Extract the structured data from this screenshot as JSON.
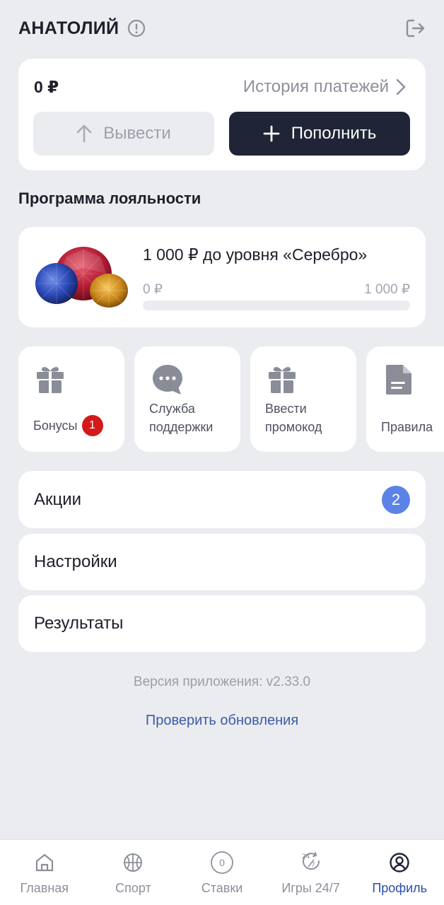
{
  "header": {
    "user_name": "АНАТОЛИЙ"
  },
  "balance": {
    "amount": "0 ₽",
    "history_label": "История платежей",
    "withdraw_label": "Вывести",
    "deposit_label": "Пополнить"
  },
  "loyalty": {
    "section_title": "Программа лояльности",
    "title": "1 000 ₽ до уровня «Серебро»",
    "min_label": "0 ₽",
    "max_label": "1 000 ₽",
    "progress": 0
  },
  "tiles": [
    {
      "label": "Бонусы",
      "badge": "1",
      "icon": "gift-icon"
    },
    {
      "label": "Служба\nподдержки",
      "icon": "chat-icon"
    },
    {
      "label": "Ввести\nпромокод",
      "icon": "gift-icon"
    },
    {
      "label": "Правила",
      "icon": "document-icon"
    }
  ],
  "menu": {
    "promotions": {
      "label": "Акции",
      "badge": "2"
    },
    "settings": {
      "label": "Настройки"
    },
    "results": {
      "label": "Результаты"
    }
  },
  "footer": {
    "version": "Версия приложения: v2.33.0",
    "check_updates": "Проверить обновления"
  },
  "tabbar": {
    "home": "Главная",
    "sport": "Спорт",
    "bets": "Ставки",
    "bets_count": "0",
    "games": "Игры 24/7",
    "profile": "Профиль"
  },
  "colors": {
    "background": "#ebecf0",
    "card": "#ffffff",
    "dark_button": "#1f2436",
    "accent_blue": "#5b83e6",
    "link_blue": "#3c5ba8",
    "badge_red": "#d21a1a"
  }
}
